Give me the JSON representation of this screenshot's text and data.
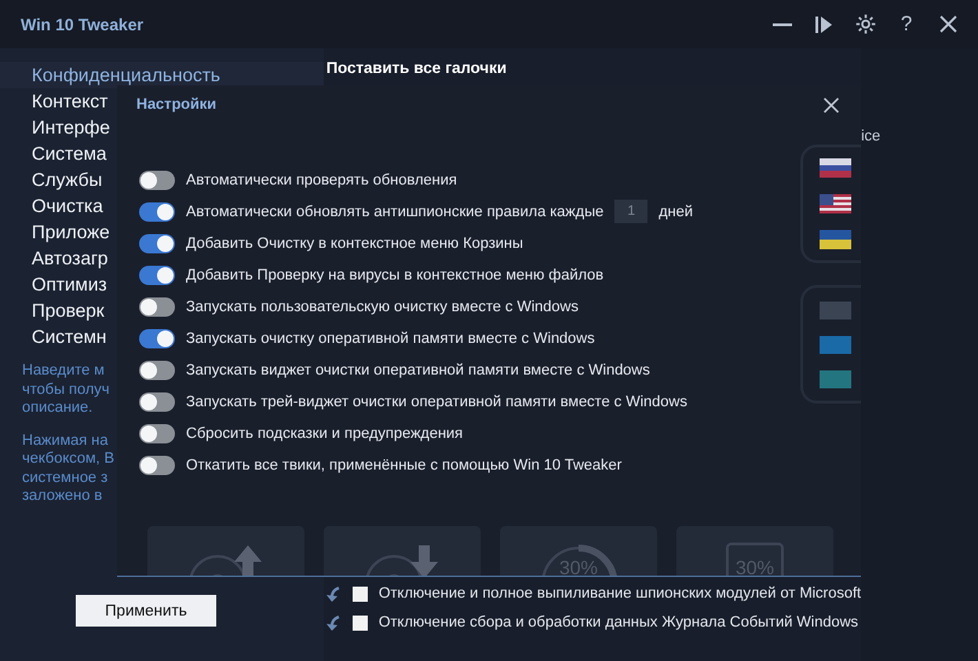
{
  "window": {
    "title": "Win 10 Tweaker",
    "help_glyph": "?"
  },
  "sidebar": {
    "items": [
      {
        "label": "Конфиденциальность",
        "selected": true
      },
      {
        "label": "Контекст",
        "selected": false
      },
      {
        "label": "Интерфе",
        "selected": false
      },
      {
        "label": "Система",
        "selected": false
      },
      {
        "label": "Службы",
        "selected": false
      },
      {
        "label": "Очистка",
        "selected": false
      },
      {
        "label": "Приложе",
        "selected": false
      },
      {
        "label": "Автозагр",
        "selected": false
      },
      {
        "label": "Оптимиз",
        "selected": false
      },
      {
        "label": "Проверк",
        "selected": false
      },
      {
        "label": "Системн",
        "selected": false
      }
    ],
    "hints": [
      [
        "Наведите м",
        "чтобы получ",
        "описание."
      ],
      [
        "Нажимая на",
        "чекбоксом, В",
        "системное з",
        "заложено в"
      ]
    ],
    "apply_button": "Применить"
  },
  "main": {
    "header": "Поставить все галочки",
    "side_text": "ice",
    "checkboxes": [
      {
        "label": "Отключение и полное выпиливание шпионских модулей от Microsoft",
        "checked": false
      },
      {
        "label": "Отключение сбора и обработки данных Журнала Событий Windows",
        "checked": false
      }
    ]
  },
  "dialog": {
    "title": "Настройки",
    "toggles": [
      {
        "kind": "plain",
        "label": "Автоматически проверять обновления",
        "on": false
      },
      {
        "kind": "with_field",
        "label": "Автоматически обновлять антишпионские правила каждые",
        "value": "1",
        "suffix": "дней",
        "on": true
      },
      {
        "kind": "plain",
        "label": "Добавить Очистку в контекстное меню Корзины",
        "on": true
      },
      {
        "kind": "plain",
        "label": "Добавить Проверку на вирусы в контекстное меню файлов",
        "on": true
      },
      {
        "kind": "plain",
        "label": "Запускать пользовательскую очистку вместе с Windows",
        "on": false
      },
      {
        "kind": "plain",
        "label": "Запускать очистку оперативной памяти вместе с Windows",
        "on": true
      },
      {
        "kind": "plain",
        "label": "Запускать виджет очистки оперативной памяти вместе с Windows",
        "on": false
      },
      {
        "kind": "plain",
        "label": "Запускать трей-виджет очистки оперативной памяти вместе с Windows",
        "on": false
      },
      {
        "kind": "plain",
        "label": "Сбросить подсказки и предупреждения",
        "on": false
      },
      {
        "kind": "plain",
        "label": "Откатить все твики, применённые с помощью Win 10 Tweaker",
        "on": false
      }
    ],
    "tiles": [
      {
        "kind": "upload"
      },
      {
        "kind": "download"
      },
      {
        "kind": "ring",
        "label": "30%"
      },
      {
        "kind": "square",
        "label": "30%"
      }
    ],
    "flags": [
      {
        "kind": "ru"
      },
      {
        "kind": "us"
      },
      {
        "kind": "ua"
      }
    ],
    "swatches": [
      {
        "color": "#3a4452"
      },
      {
        "color": "#1a6aa8"
      },
      {
        "color": "#237580"
      }
    ]
  }
}
